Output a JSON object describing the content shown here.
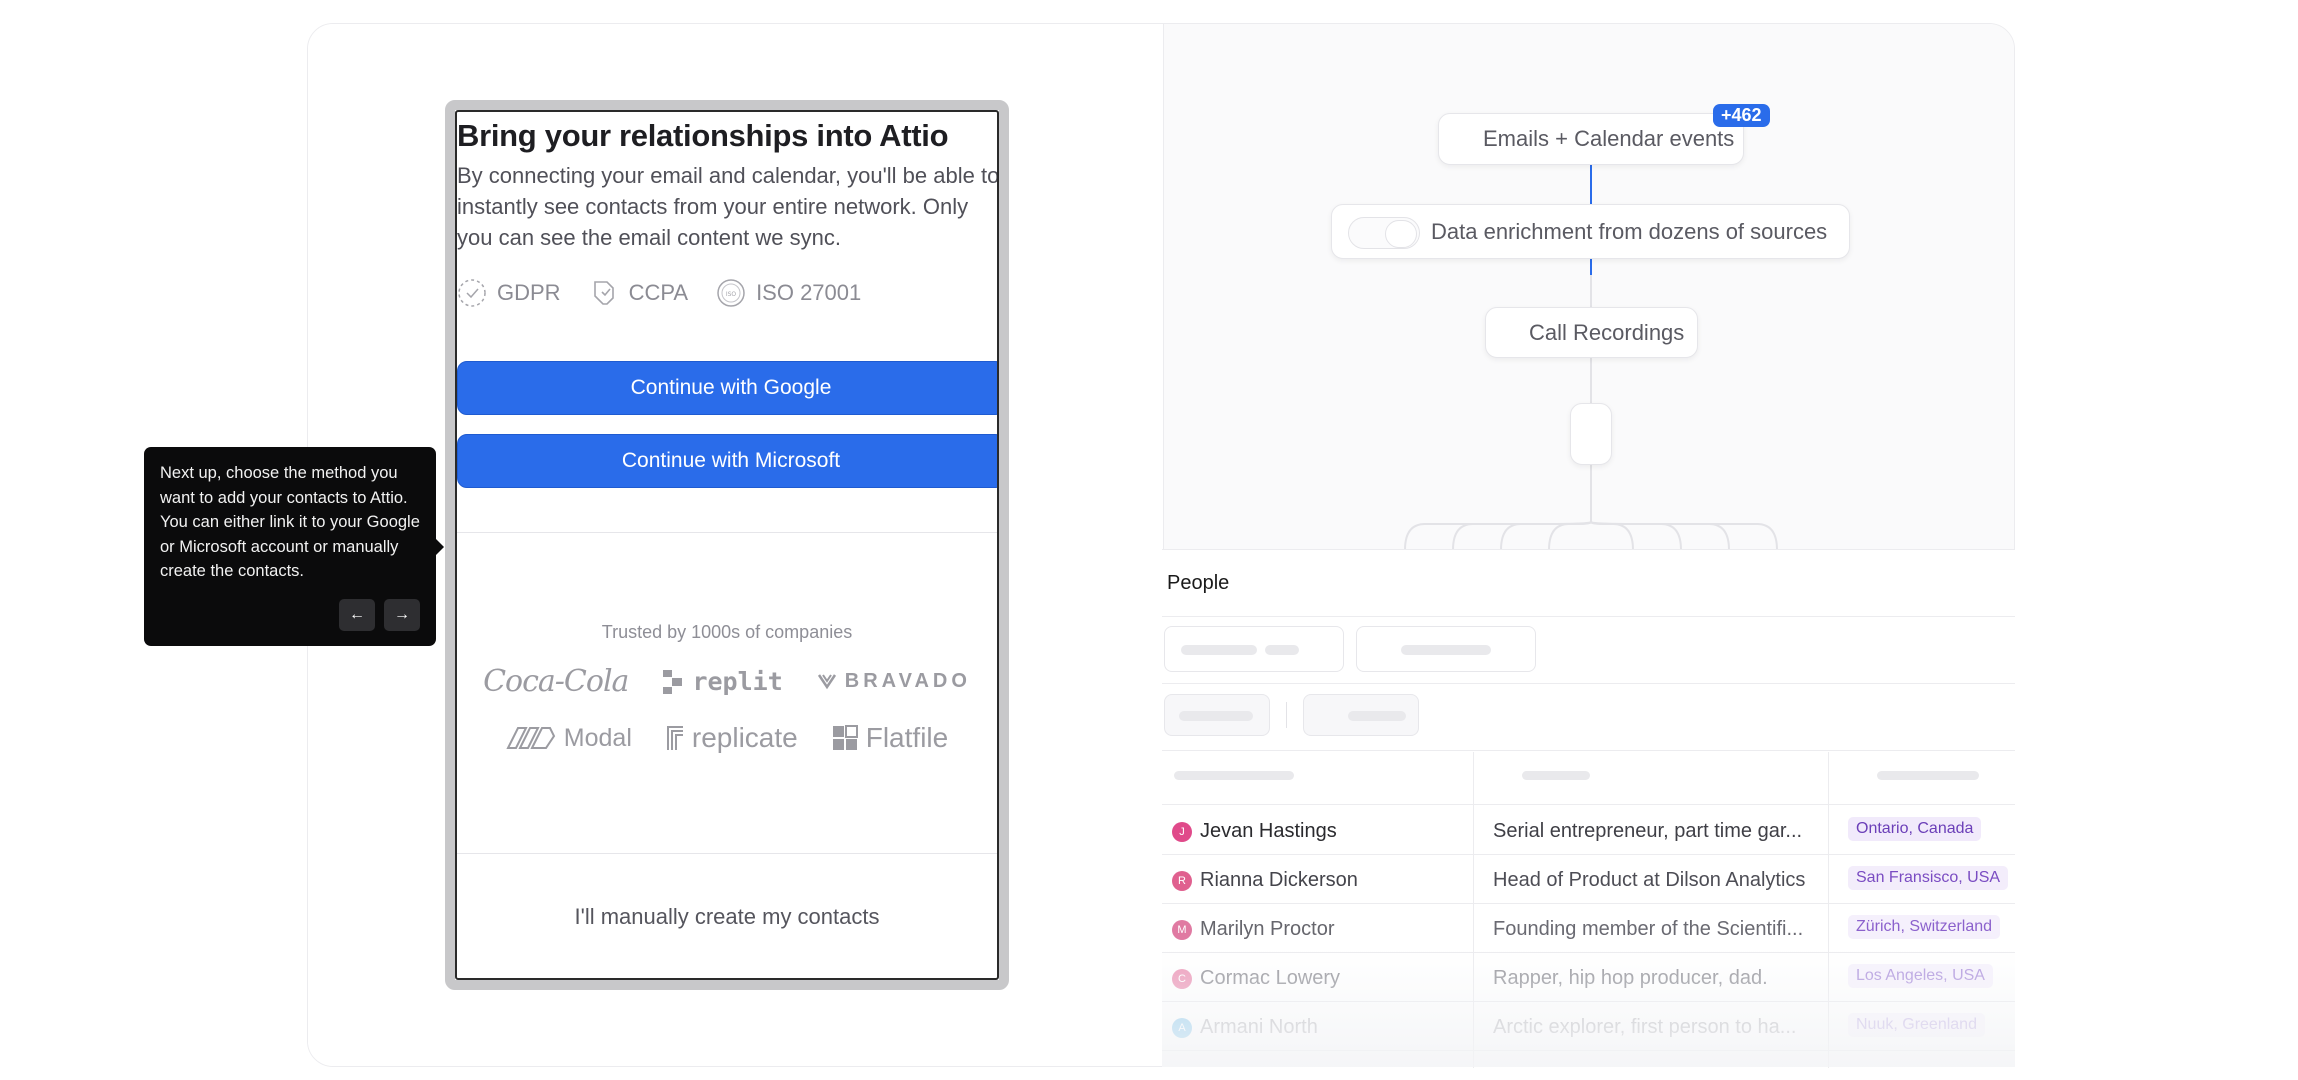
{
  "onboarding": {
    "title": "Bring your relationships into Attio",
    "description": "By connecting your email and calendar, you'll be able to instantly see contacts from your entire network. Only you can see the email content we sync.",
    "compliance": [
      {
        "label": "GDPR",
        "icon": "gdpr-icon"
      },
      {
        "label": "CCPA",
        "icon": "ccpa-icon"
      },
      {
        "label": "ISO 27001",
        "icon": "iso-icon"
      }
    ],
    "google_button": "Continue with Google",
    "microsoft_button": "Continue with Microsoft",
    "trusted_text": "Trusted by 1000s of companies",
    "logos": [
      "Coca-Cola",
      "replit",
      "BRAVADO",
      "Modal",
      "replicate",
      "Flatfile"
    ],
    "manual_link": "I'll manually create my contacts",
    "accent_color": "#2a6cea"
  },
  "tooltip": {
    "text": "Next up, choose the method you want to add your contacts to Attio. You can either link it to your Google or Microsoft account or manually create the contacts.",
    "prev_icon": "←",
    "next_icon": "→"
  },
  "diagram": {
    "node_emails": "Emails + Calendar events",
    "badge": "+462",
    "node_data": "Data enrichment from dozens of sources",
    "node_calls": "Call Recordings"
  },
  "people": {
    "title": "People",
    "rows": [
      {
        "initial": "J",
        "name": "Jevan Hastings",
        "role": "Serial entrepreneur, part time gar...",
        "location": "Ontario, Canada",
        "avatar_color": "#e04a8a"
      },
      {
        "initial": "R",
        "name": "Rianna Dickerson",
        "role": "Head of Product at Dilson Analytics",
        "location": "San Fransisco, USA",
        "avatar_color": "#e0608f"
      },
      {
        "initial": "M",
        "name": "Marilyn Proctor",
        "role": "Founding member of the Scientifi...",
        "location": "Zürich, Switzerland",
        "avatar_color": "#e07aa2"
      },
      {
        "initial": "C",
        "name": "Cormac Lowery",
        "role": "Rapper, hip hop producer, dad.",
        "location": "Los Angeles, USA",
        "avatar_color": "#ee9fbd"
      },
      {
        "initial": "A",
        "name": "Armani North",
        "role": "Arctic explorer, first person to ha...",
        "location": "Nuuk, Greenland",
        "avatar_color": "#9fd3f0"
      }
    ]
  }
}
